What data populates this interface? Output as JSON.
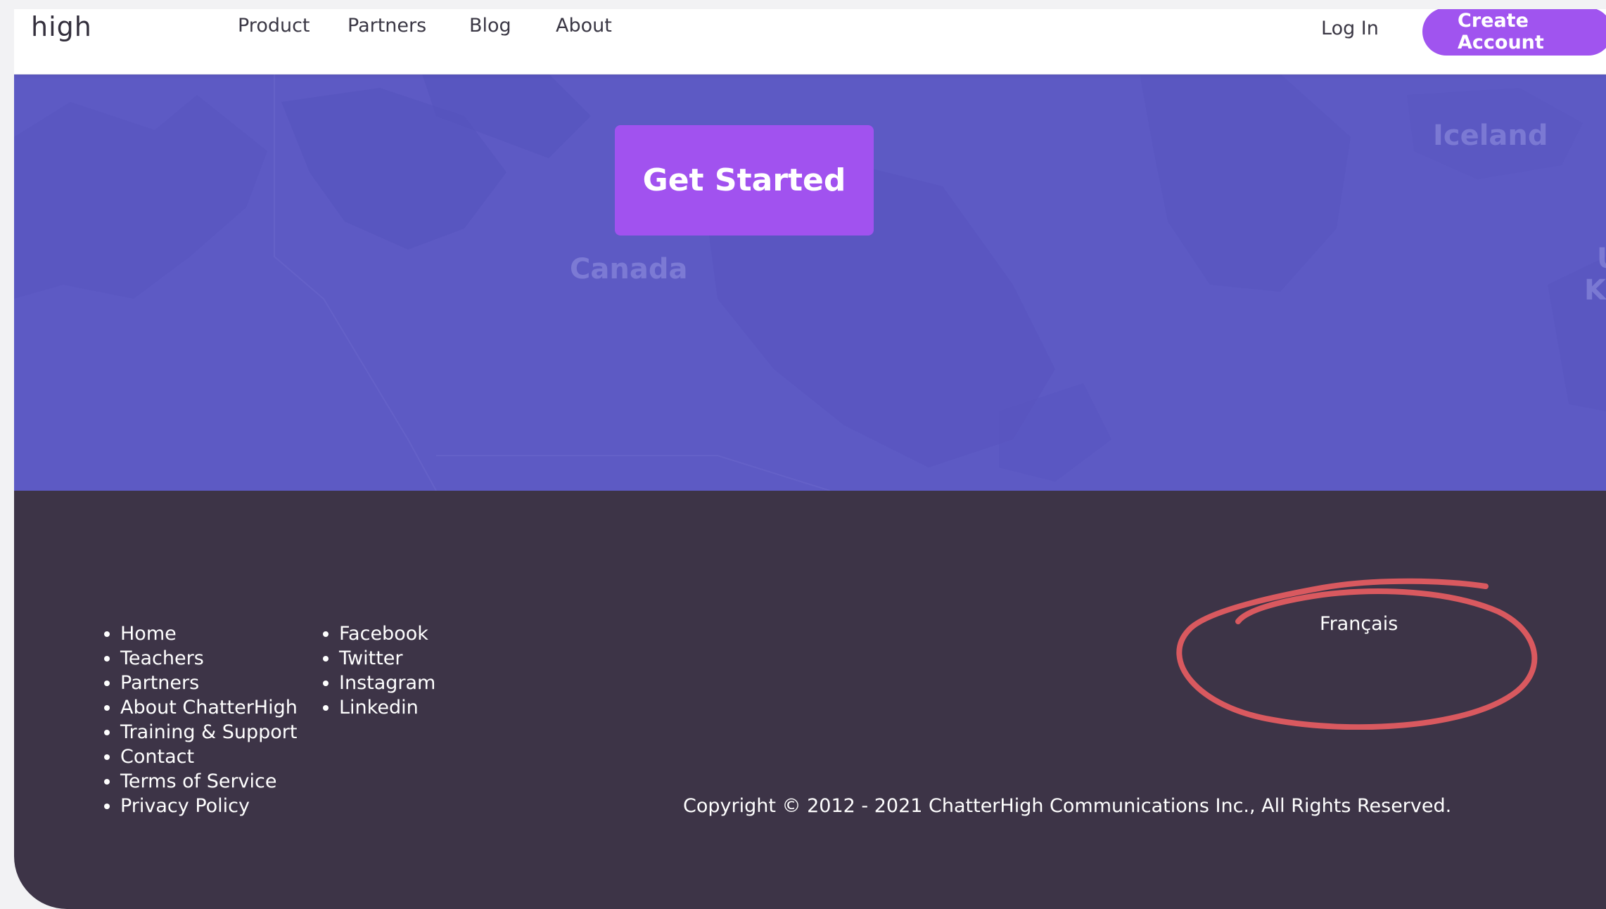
{
  "header": {
    "logo_text": "high",
    "nav": [
      "Product",
      "Partners",
      "Blog",
      "About"
    ],
    "login_label": "Log In",
    "create_account_label": "Create Account"
  },
  "hero": {
    "cta_label": "Get Started",
    "map_labels": [
      "Canada",
      "Iceland",
      "U",
      "Ki"
    ]
  },
  "footer": {
    "site_links": [
      "Home",
      "Teachers",
      "Partners",
      "About ChatterHigh",
      "Training & Support",
      "Contact",
      "Terms of Service",
      "Privacy Policy"
    ],
    "social_links": [
      "Facebook",
      "Twitter",
      "Instagram",
      "Linkedin"
    ],
    "language_label": "Français",
    "copyright": "Copyright © 2012 - 2021 ChatterHigh Communications Inc., All Rights Reserved."
  },
  "colors": {
    "accent": "#a054ef",
    "hero_bg": "#5d5ac4",
    "footer_bg": "#3d3447",
    "annotation": "#d9595f"
  }
}
